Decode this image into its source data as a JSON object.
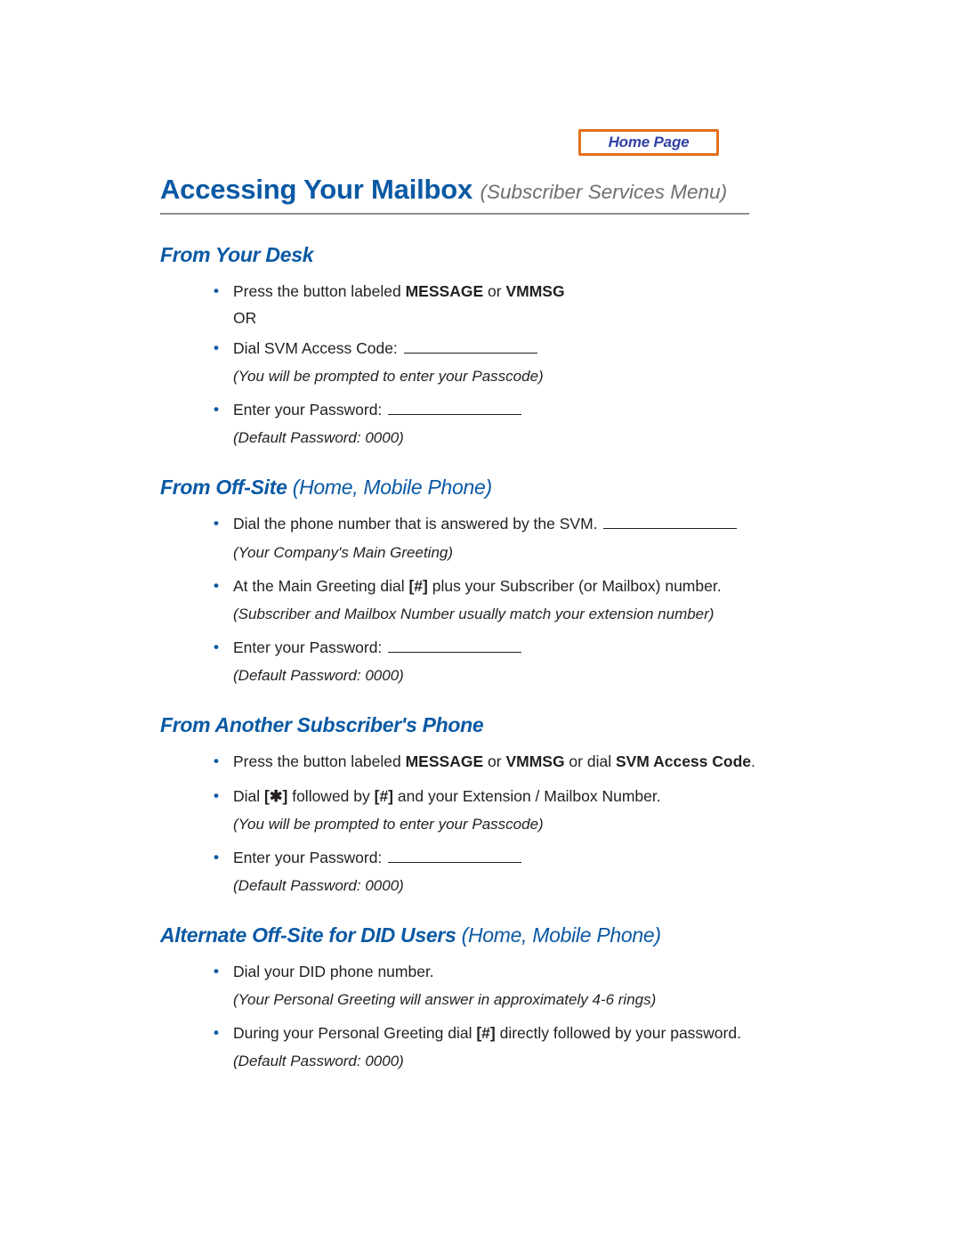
{
  "home_button": {
    "label": "Home Page"
  },
  "title": {
    "main": "Accessing Your Mailbox",
    "sub": "(Subscriber Services Menu)"
  },
  "sections": {
    "desk": {
      "heading": "From Your Desk",
      "item1_pre": "Press the button labeled ",
      "item1_b1": "MESSAGE",
      "item1_mid": " or ",
      "item1_b2": "VMMSG",
      "or": "OR",
      "item2": "Dial SVM Access Code:",
      "note2": "(You will be prompted to enter your Passcode)",
      "item3": "Enter your Password:",
      "note3": "(Default Password: 0000)"
    },
    "offsite": {
      "heading_main": "From Off-Site",
      "heading_paren": "(Home, Mobile Phone)",
      "item1": "Dial the phone number that is answered by the SVM.",
      "note1": "(Your Company's Main Greeting)",
      "item2_pre": "At the Main Greeting dial ",
      "item2_b": "[#]",
      "item2_post": " plus your Subscriber (or Mailbox) number.",
      "note2": "(Subscriber and Mailbox Number usually match your extension number)",
      "item3": "Enter your Password:",
      "note3": "(Default Password: 0000)"
    },
    "another": {
      "heading": "From Another Subscriber's Phone",
      "item1_pre": "Press the button labeled ",
      "item1_b1": "MESSAGE",
      "item1_mid1": " or ",
      "item1_b2": "VMMSG",
      "item1_mid2": " or dial ",
      "item1_b3": "SVM Access Code",
      "item1_post": ".",
      "item2_pre": "Dial ",
      "item2_b1": "[✱]",
      "item2_mid": " followed by ",
      "item2_b2": "[#]",
      "item2_post": "  and your Extension / Mailbox Number.",
      "note2": "(You will be prompted to enter your Passcode)",
      "item3": "Enter your Password:",
      "note3": "(Default Password: 0000)"
    },
    "did": {
      "heading_main": "Alternate Off-Site for DID Users",
      "heading_paren": "(Home, Mobile Phone)",
      "item1": "Dial your DID phone number.",
      "note1": "(Your Personal Greeting will answer in approximately 4-6 rings)",
      "item2_pre": "During your Personal Greeting dial ",
      "item2_b": "[#]",
      "item2_post": " directly followed by your password.",
      "note2": "(Default Password: 0000)"
    }
  }
}
